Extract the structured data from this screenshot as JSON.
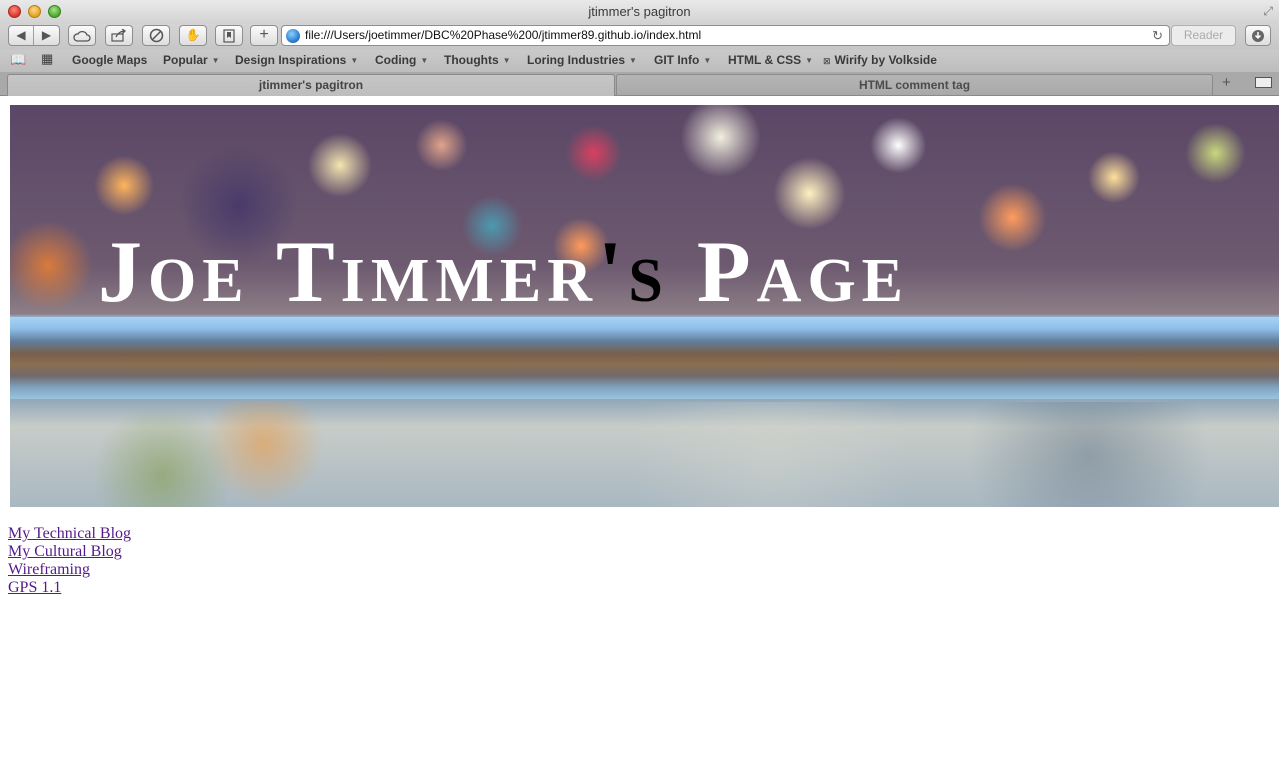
{
  "window": {
    "title": "jtimmer's pagitron"
  },
  "toolbar": {
    "url": "file:///Users/joetimmer/DBC%20Phase%200/jtimmer89.github.io/index.html",
    "reader_label": "Reader"
  },
  "bookmarks": [
    {
      "label": "Google Maps",
      "has_menu": false
    },
    {
      "label": "Popular",
      "has_menu": true
    },
    {
      "label": "Design Inspirations",
      "has_menu": true
    },
    {
      "label": "Coding",
      "has_menu": true
    },
    {
      "label": "Thoughts",
      "has_menu": true
    },
    {
      "label": "Loring Industries",
      "has_menu": true
    },
    {
      "label": "GIT Info",
      "has_menu": true
    },
    {
      "label": "HTML & CSS",
      "has_menu": true
    },
    {
      "label": "Wirify by Volkside",
      "has_menu": false
    }
  ],
  "tabs": [
    {
      "label": "jtimmer's pagitron",
      "active": true
    },
    {
      "label": "HTML comment tag",
      "active": false
    }
  ],
  "page": {
    "hero_title_part1": "Joe Timmer",
    "hero_title_part2": "'s",
    "hero_title_part3": " Page",
    "links": [
      {
        "label": "My Technical Blog"
      },
      {
        "label": "My Cultural Blog"
      },
      {
        "label": "Wireframing"
      },
      {
        "label": "GPS 1.1"
      }
    ]
  },
  "colors": {
    "visited_link": "#551a8b",
    "title_text": "#ffffff"
  }
}
